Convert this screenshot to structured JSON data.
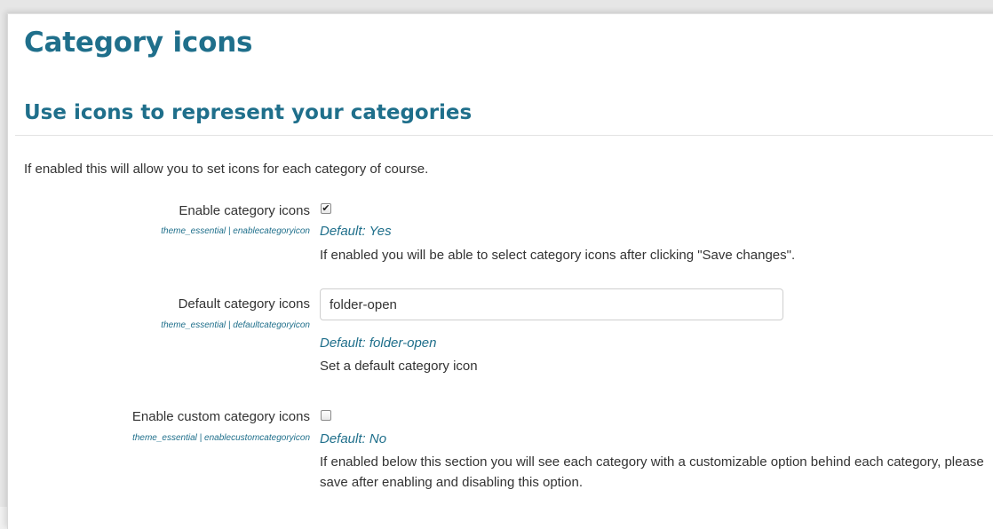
{
  "page": {
    "title": "Category icons"
  },
  "section": {
    "title": "Use icons to represent your categories",
    "intro": "If enabled this will allow you to set icons for each category of course."
  },
  "settings": [
    {
      "label": "Enable category icons",
      "id": "theme_essential | enablecategoryicon",
      "type": "checkbox",
      "checked": true,
      "check_glyph": "✔",
      "default": "Default: Yes",
      "description": "If enabled you will be able to select category icons after clicking \"Save changes\"."
    },
    {
      "label": "Default category icons",
      "id": "theme_essential | defaultcategoryicon",
      "type": "text",
      "value": "folder-open",
      "default": "Default: folder-open",
      "description": "Set a default category icon"
    },
    {
      "label": "Enable custom category icons",
      "id": "theme_essential | enablecustomcategoryicon",
      "type": "checkbox",
      "checked": false,
      "check_glyph": "",
      "default": "Default: No",
      "description": "If enabled below this section you will see each category with a customizable option behind each category, please save after enabling and disabling this option."
    }
  ],
  "colors": {
    "heading": "#1f6f8b",
    "body_text": "#333333",
    "background": "#ffffff"
  }
}
